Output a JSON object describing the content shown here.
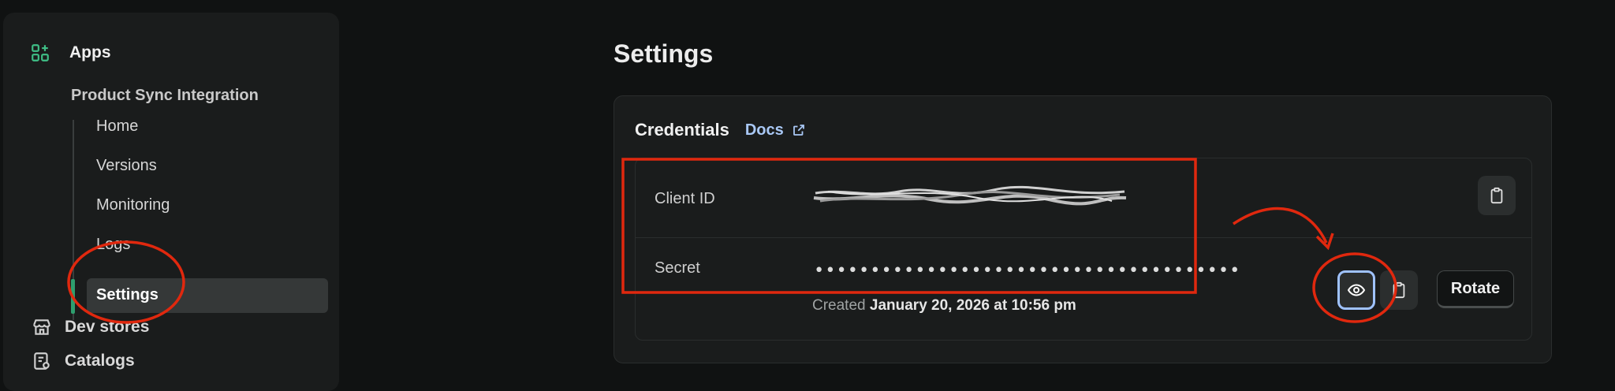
{
  "sidebar": {
    "apps_label": "Apps",
    "app_name": "Product Sync Integration",
    "subnav": [
      {
        "label": "Home"
      },
      {
        "label": "Versions"
      },
      {
        "label": "Monitoring"
      },
      {
        "label": "Logs"
      },
      {
        "label": "Settings"
      }
    ],
    "dev_stores_label": "Dev stores",
    "catalogs_label": "Catalogs"
  },
  "main": {
    "title": "Settings",
    "credentials": {
      "title": "Credentials",
      "docs_label": "Docs",
      "client_id_label": "Client ID",
      "secret_label": "Secret",
      "secret_masked": "••••••••••••••••••••••••••••••••••••••",
      "created_prefix": "Created",
      "created_date": "January 20, 2026 at 10:56 pm",
      "rotate_label": "Rotate"
    }
  },
  "colors": {
    "accent_green": "#2e9e6e",
    "link_blue": "#a9c8f5",
    "annotation_red": "#e0280e"
  },
  "icons": [
    "apps-icon",
    "external-link-icon",
    "clipboard-icon",
    "eye-icon",
    "store-icon",
    "catalog-icon"
  ]
}
